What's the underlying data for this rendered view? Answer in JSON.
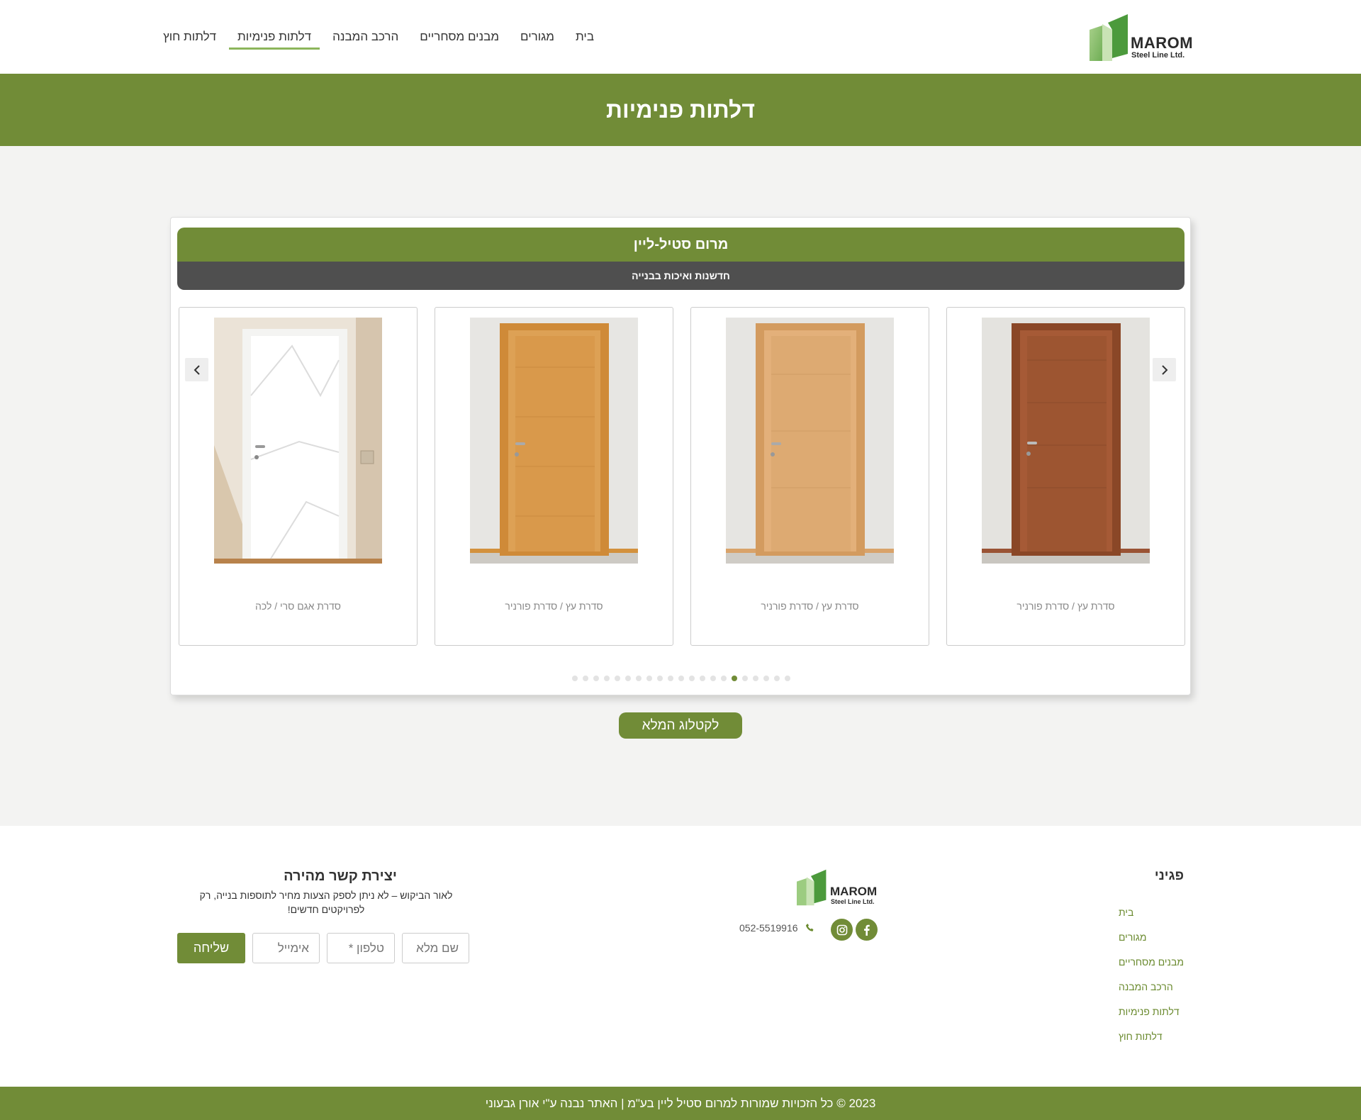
{
  "header": {
    "logo": {
      "brand": "MAROM",
      "sub": "Steel Line Ltd."
    },
    "nav": [
      {
        "label": "בית",
        "active": false
      },
      {
        "label": "מגורים",
        "active": false
      },
      {
        "label": "מבנים מסחריים",
        "active": false
      },
      {
        "label": "הרכב המבנה",
        "active": false
      },
      {
        "label": "דלתות פנימיות",
        "active": true
      },
      {
        "label": "דלתות חוץ",
        "active": false
      }
    ]
  },
  "page": {
    "title": "דלתות פנימיות"
  },
  "carousel": {
    "title": "מרום סטיל-ליין",
    "subtitle": "חדשנות ואיכות בבנייה",
    "products": [
      {
        "caption": "סדרת עץ / סדרת פורניר",
        "door": "walnut-veneer-door"
      },
      {
        "caption": "סדרת עץ / סדרת פורניר",
        "door": "light-oak-door"
      },
      {
        "caption": "סדרת עץ / סדרת פורניר",
        "door": "oak-veneer-door"
      },
      {
        "caption": "סדרת אגם סרי / לכה",
        "door": "white-lacquer-door"
      }
    ],
    "dots_total": 21,
    "dots_active_index": 15,
    "catalog_button": "לקטלוג המלא"
  },
  "colors": {
    "brand_green": "#718c37",
    "dark_gray": "#4f4f4f",
    "link_green": "#6a8a2e"
  },
  "footer": {
    "pages_title": "פגיני",
    "links": [
      "בית",
      "מגורים",
      "מבנים מסחריים",
      "הרכב המבנה",
      "דלתות פנימיות",
      "דלתות חוץ"
    ],
    "logo": {
      "brand": "MAROM",
      "sub": "Steel Line Ltd."
    },
    "phone": "052-5519916",
    "social": [
      "facebook-icon",
      "instagram-icon"
    ],
    "contact": {
      "title": "יצירת קשר מהירה",
      "description": "לאור הביקוש – לא ניתן לספק הצעות מחיר לתוספות בנייה, רק לפרויקטים חדשים!",
      "name_placeholder": "שם מלא",
      "phone_placeholder": "טלפון *",
      "email_placeholder": "אימייל",
      "send_label": "שליחה"
    },
    "copyright": "2023 © כל הזכויות שמורות למרום סטיל ליין בע\"מ | האתר נבנה ע\"י אורן גבעוני"
  }
}
